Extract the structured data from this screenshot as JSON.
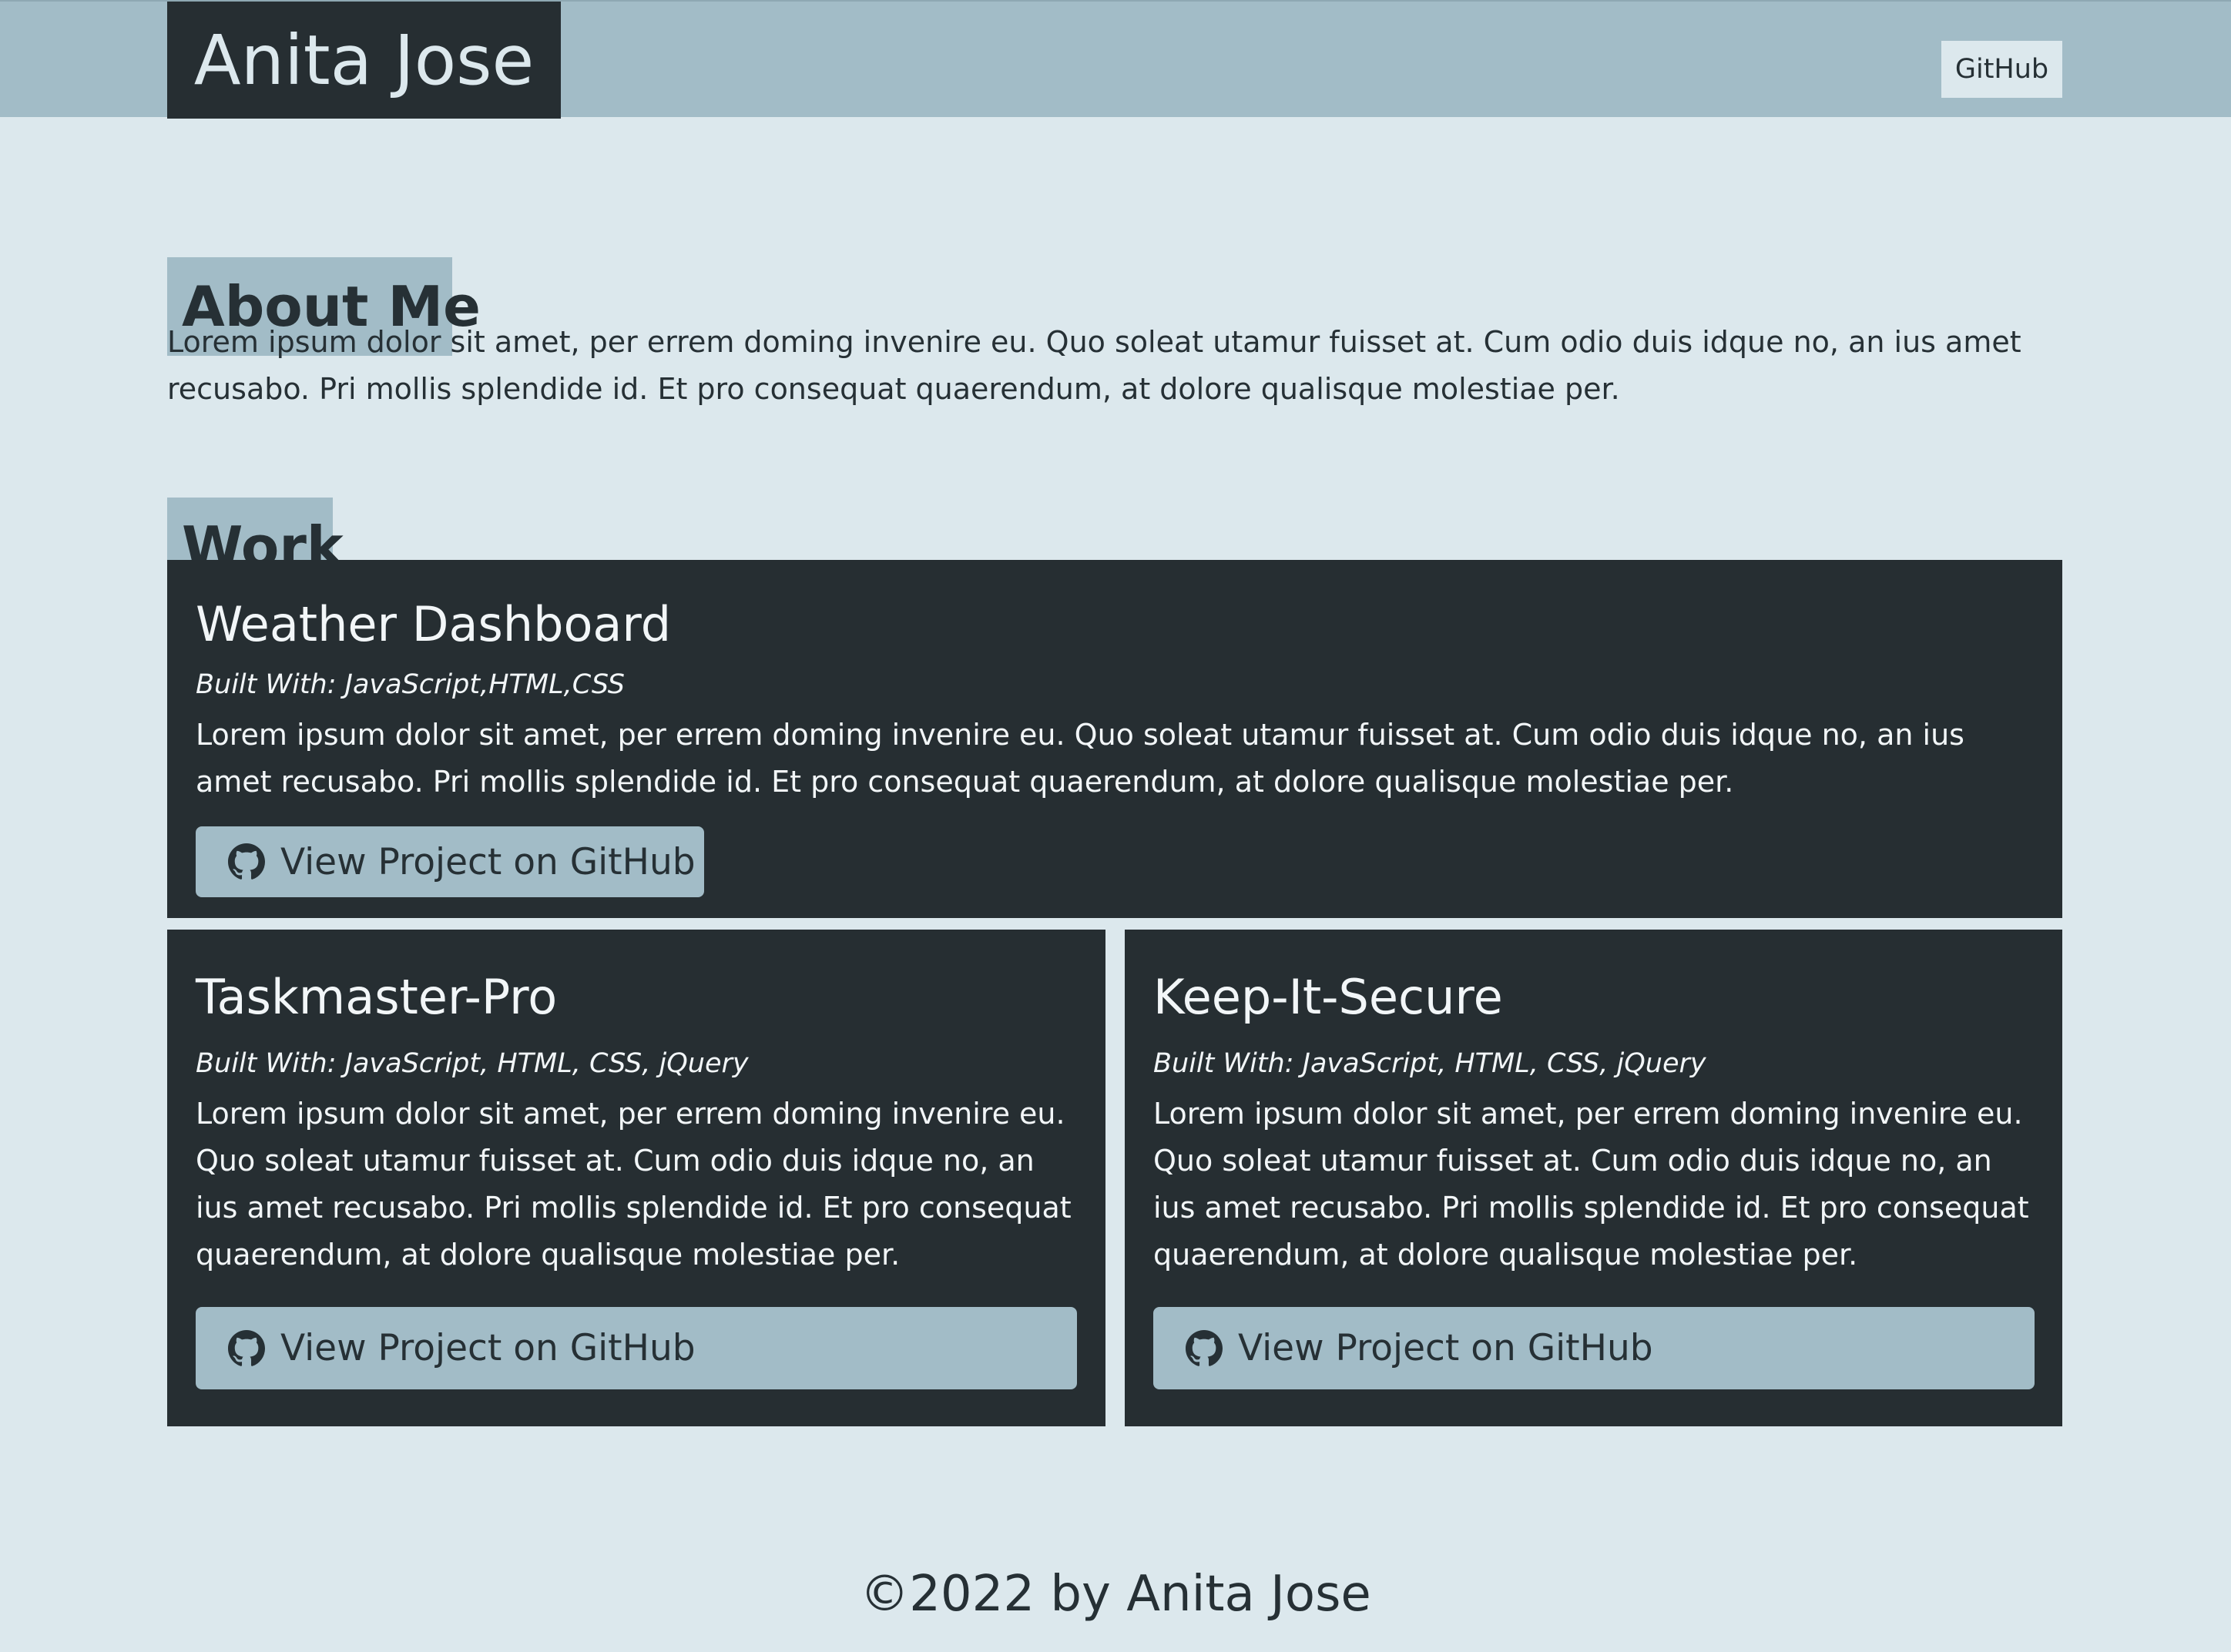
{
  "header": {
    "brand": "Anita Jose",
    "nav_link": "GitHub"
  },
  "about": {
    "title": "About Me",
    "text": "Lorem ipsum dolor sit amet, per errem doming invenire eu. Quo soleat utamur fuisset at. Cum odio duis idque no, an ius amet recusabo. Pri mollis splendide id. Et pro consequat quaerendum, at dolore qualisque molestiae per."
  },
  "work": {
    "title": "Work",
    "projects": [
      {
        "title": "Weather Dashboard",
        "built_with": "Built With: JavaScript,HTML,CSS",
        "description": "Lorem ipsum dolor sit amet, per errem doming invenire eu. Quo soleat utamur fuisset at. Cum odio duis idque no, an ius amet recusabo. Pri mollis splendide id. Et pro consequat quaerendum, at dolore qualisque molestiae per.",
        "button_label": "View Project on GitHub"
      },
      {
        "title": "Taskmaster-Pro",
        "built_with": "Built With: JavaScript, HTML, CSS, jQuery",
        "description": "Lorem ipsum dolor sit amet, per errem doming invenire eu. Quo soleat utamur fuisset at. Cum odio duis idque no, an ius amet recusabo. Pri mollis splendide id. Et pro consequat quaerendum, at dolore qualisque molestiae per.",
        "button_label": "View Project on GitHub"
      },
      {
        "title": "Keep-It-Secure",
        "built_with": "Built With: JavaScript, HTML, CSS, jQuery",
        "description": "Lorem ipsum dolor sit amet, per errem doming invenire eu. Quo soleat utamur fuisset at. Cum odio duis idque no, an ius amet recusabo. Pri mollis splendide id. Et pro consequat quaerendum, at dolore qualisque molestiae per.",
        "button_label": "View Project on GitHub"
      }
    ]
  },
  "footer": {
    "text": "©2022 by Anita Jose"
  },
  "icons": {
    "github": "github-icon"
  },
  "colors": {
    "background": "#dce8ed",
    "accent": "#a2bcc7",
    "dark": "#262e32"
  }
}
